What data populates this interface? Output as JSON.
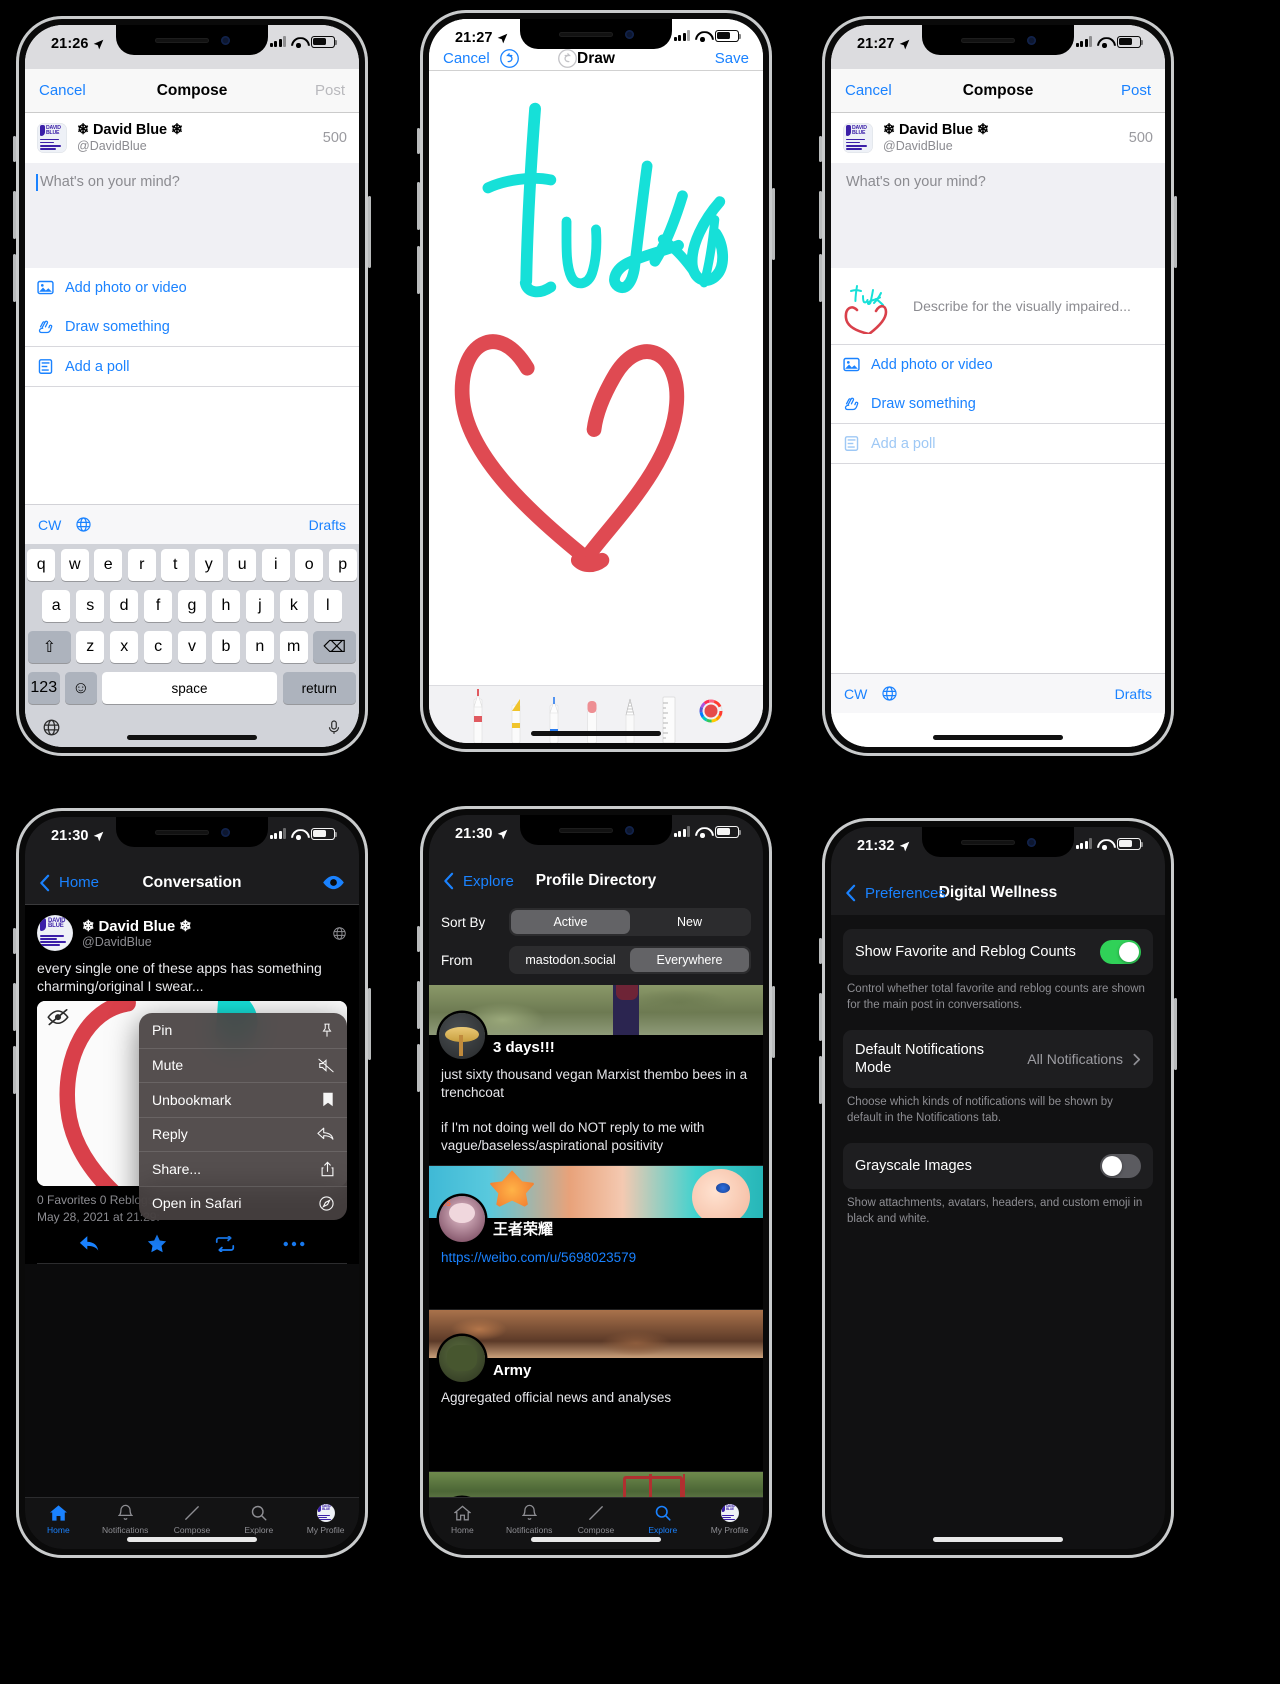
{
  "phones": {
    "compose_empty": {
      "status": {
        "time": "21:26"
      },
      "nav": {
        "cancel": "Cancel",
        "title": "Compose",
        "post": "Post"
      },
      "account": {
        "name": "❄ David Blue ❄",
        "handle": "@DavidBlue",
        "counter": "500"
      },
      "editor": {
        "placeholder": "What's on your mind?"
      },
      "actions": [
        {
          "label": "Add photo or video",
          "icon": "photo-icon"
        },
        {
          "label": "Draw something",
          "icon": "draw-hand-icon"
        },
        {
          "label": "Add a poll",
          "icon": "poll-icon"
        }
      ],
      "toolbar": {
        "cw": "CW",
        "globe": "globe-icon",
        "drafts": "Drafts"
      },
      "keyboard": {
        "row1": [
          "q",
          "w",
          "e",
          "r",
          "t",
          "y",
          "u",
          "i",
          "o",
          "p"
        ],
        "row2": [
          "a",
          "s",
          "d",
          "f",
          "g",
          "h",
          "j",
          "k",
          "l"
        ],
        "row3": [
          "z",
          "x",
          "c",
          "v",
          "b",
          "n",
          "m"
        ],
        "shift": "⇧",
        "backspace": "⌫",
        "numbers": "123",
        "emoji": "☺",
        "space": "space",
        "return": "return"
      }
    },
    "draw": {
      "status": {
        "time": "21:27"
      },
      "nav": {
        "cancel": "Cancel",
        "undo": "undo-icon",
        "redo": "redo-icon",
        "title": "Draw",
        "save": "Save"
      },
      "tools": [
        "pen-tool",
        "highlighter-tool",
        "marker-tool",
        "eraser-tool",
        "lasso-tool",
        "ruler-tool",
        "color-picker"
      ],
      "strokes": {
        "ink_color": "#16e0d8",
        "heart_color": "#df4a52"
      }
    },
    "compose_attached": {
      "status": {
        "time": "21:27"
      },
      "nav": {
        "cancel": "Cancel",
        "title": "Compose",
        "post": "Post"
      },
      "account": {
        "name": "❄ David Blue ❄",
        "handle": "@DavidBlue",
        "counter": "500"
      },
      "editor": {
        "placeholder": "What's on your mind?"
      },
      "attachment": {
        "alt_placeholder": "Describe for the visually impaired..."
      },
      "actions": [
        {
          "label": "Add photo or video",
          "icon": "photo-icon",
          "disabled": false
        },
        {
          "label": "Draw something",
          "icon": "draw-hand-icon",
          "disabled": false
        },
        {
          "label": "Add a poll",
          "icon": "poll-icon",
          "disabled": true
        }
      ],
      "toolbar": {
        "cw": "CW",
        "globe": "globe-icon",
        "drafts": "Drafts"
      }
    },
    "conversation": {
      "status": {
        "time": "21:30"
      },
      "nav": {
        "back": "Home",
        "title": "Conversation",
        "eye": "eye-icon"
      },
      "post": {
        "name": "❄ David Blue ❄",
        "handle": "@DavidBlue",
        "visibility": "globe-icon",
        "body": "every single one of these apps has something charming/original I swear...",
        "meta": "0 Favorites  0 Reblogs",
        "date": "May 28, 2021 at 21:29:"
      },
      "context_menu": [
        {
          "label": "Pin",
          "icon": "pin-icon"
        },
        {
          "label": "Mute",
          "icon": "mute-icon"
        },
        {
          "label": "Unbookmark",
          "icon": "bookmark-icon"
        },
        {
          "label": "Reply",
          "icon": "reply-icon"
        },
        {
          "label": "Share...",
          "icon": "share-icon",
          "group": 2
        },
        {
          "label": "Open in Safari",
          "icon": "safari-icon",
          "group": 2
        }
      ],
      "post_actions": [
        "reply-icon",
        "favorite-star-icon",
        "reblog-icon",
        "more-icon"
      ],
      "tabs": [
        {
          "label": "Home",
          "icon": "home-icon",
          "active": true
        },
        {
          "label": "Notifications",
          "icon": "bell-icon",
          "active": false
        },
        {
          "label": "Compose",
          "icon": "pencil-icon",
          "active": false
        },
        {
          "label": "Explore",
          "icon": "search-icon",
          "active": false
        },
        {
          "label": "My Profile",
          "icon": "avatar-icon",
          "active": false
        }
      ]
    },
    "profile_directory": {
      "status": {
        "time": "21:30"
      },
      "nav": {
        "back": "Explore",
        "title": "Profile Directory"
      },
      "filters": [
        {
          "label": "Sort By",
          "options": [
            "Active",
            "New"
          ],
          "selected": "Active"
        },
        {
          "label": "From",
          "options": [
            "mastodon.social",
            "Everywhere"
          ],
          "selected": "Everywhere"
        }
      ],
      "profiles": [
        {
          "display_name": "3 days!!!",
          "note": "just sixty thousand vegan Marxist thembo bees in a trenchcoat\n\nif I'm not doing well do NOT reply to me with vague/baseless/aspirational positivity",
          "link": ""
        },
        {
          "display_name": "王者荣耀",
          "note": "",
          "link": "https://weibo.com/u/5698023579"
        },
        {
          "display_name": "Army",
          "note": "Aggregated official news and analyses",
          "link": ""
        },
        {
          "display_name": "",
          "note": "",
          "link": ""
        }
      ],
      "tabs": [
        {
          "label": "Home",
          "icon": "home-icon",
          "active": false
        },
        {
          "label": "Notifications",
          "icon": "bell-icon",
          "active": false
        },
        {
          "label": "Compose",
          "icon": "pencil-icon",
          "active": false
        },
        {
          "label": "Explore",
          "icon": "search-icon",
          "active": true
        },
        {
          "label": "My Profile",
          "icon": "avatar-icon",
          "active": false
        }
      ]
    },
    "digital_wellness": {
      "status": {
        "time": "21:32"
      },
      "nav": {
        "back": "Preferences",
        "title": "Digital Wellness"
      },
      "settings": [
        {
          "label": "Show Favorite and Reblog Counts",
          "control": "toggle",
          "state": "on",
          "footer": "Control whether total favorite and reblog counts are shown for the main post in conversations."
        },
        {
          "label": "Default Notifications Mode",
          "control": "value",
          "value": "All Notifications",
          "footer": "Choose which kinds of notifications will be shown by default in the Notifications tab."
        },
        {
          "label": "Grayscale Images",
          "control": "toggle",
          "state": "off",
          "footer": "Show attachments, avatars, headers, and custom emoji in black and white."
        }
      ]
    }
  },
  "colors": {
    "ios_blue": "#1a82ff",
    "green_on": "#30d158",
    "ink_cyan": "#16e0d8",
    "heart_red": "#df4a52"
  }
}
